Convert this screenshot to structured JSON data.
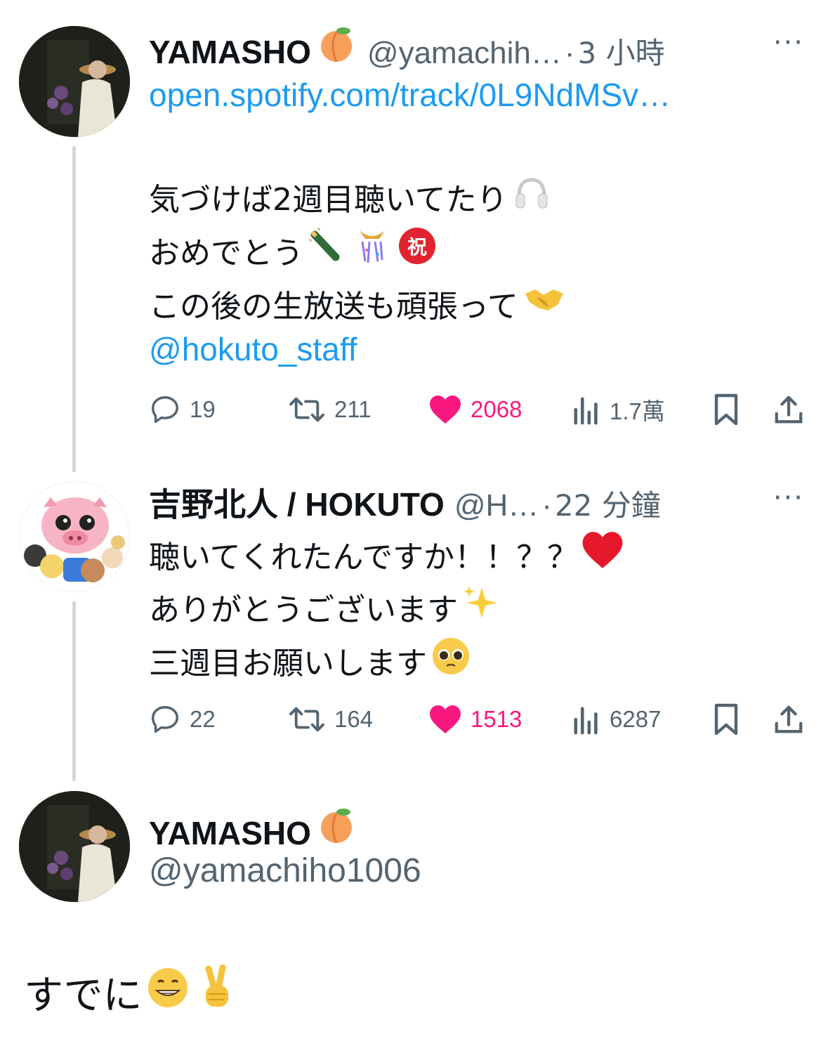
{
  "tweets": [
    {
      "author_name": "YAMASHO",
      "author_emoji": "peach-emoji",
      "handle": "@yamachih…",
      "time": "3 小時",
      "more": "···",
      "link": "open.spotify.com/track/0L9NdMSv…",
      "lines": [
        "気づけば2週目聴いてたり",
        "おめでとう",
        "この後の生放送も頑張って"
      ],
      "mention": "@hokuto_staff",
      "stats": {
        "replies": "19",
        "retweets": "211",
        "likes": "2068",
        "views": "1.7萬"
      }
    },
    {
      "author_name": "吉野北人 / HOKUTO",
      "handle": "@H…",
      "time": "22 分鐘",
      "more": "···",
      "lines": [
        "聴いてくれたんですか！！？？",
        "ありがとうございます",
        "三週目お願いします"
      ],
      "stats": {
        "replies": "22",
        "retweets": "164",
        "likes": "1513",
        "views": "6287"
      }
    },
    {
      "author_name": "YAMASHO",
      "author_emoji": "peach-emoji",
      "handle": "@yamachiho1006",
      "text": "すでに"
    }
  ],
  "colors": {
    "accent": "#1d9bf0",
    "like": "#f91880",
    "muted": "#536471",
    "text": "#0f1419"
  }
}
